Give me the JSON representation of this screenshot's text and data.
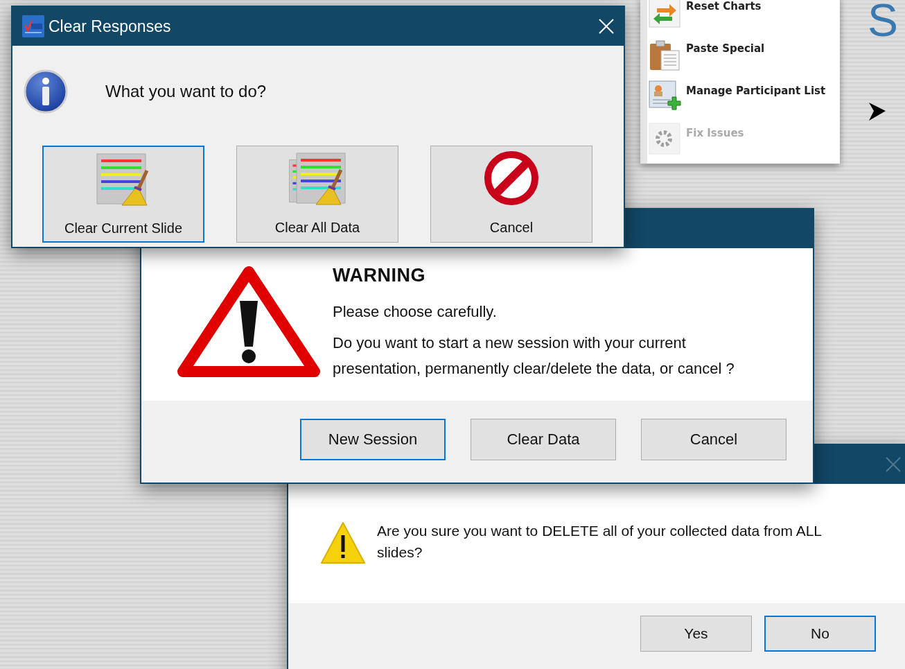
{
  "background_menu": {
    "items": [
      {
        "label": "Reset Charts",
        "kind": "reset",
        "disabled": false
      },
      {
        "label": "Paste Special",
        "kind": "paste",
        "disabled": false
      },
      {
        "label": "Manage Participant List",
        "kind": "participants",
        "disabled": false
      },
      {
        "label": "Fix Issues",
        "kind": "fix",
        "disabled": true
      }
    ]
  },
  "background_slide": {
    "title_fragment": "S"
  },
  "confirm_dialog": {
    "message": "Are you sure you want to DELETE all of your collected data from ALL slides?",
    "buttons": [
      {
        "label": "Yes",
        "focused": false
      },
      {
        "label": "No",
        "focused": true
      }
    ]
  },
  "warning_dialog": {
    "heading": "WARNING",
    "lines": [
      "Please choose carefully.",
      "Do you want to start a new session with your current presentation, permanently clear/delete the data, or cancel ?"
    ],
    "buttons": [
      {
        "label": "New Session",
        "focused": true
      },
      {
        "label": "Clear Data",
        "focused": false
      },
      {
        "label": "Cancel",
        "focused": false
      }
    ]
  },
  "clear_responses_dialog": {
    "title": "Clear Responses",
    "prompt": "What you want to do?",
    "buttons": [
      {
        "label": "Clear Current Slide",
        "kind": "clear-slide",
        "focused": true
      },
      {
        "label": "Clear All Data",
        "kind": "clear-all",
        "focused": false
      },
      {
        "label": "Cancel",
        "kind": "cancel",
        "focused": false
      }
    ]
  }
}
